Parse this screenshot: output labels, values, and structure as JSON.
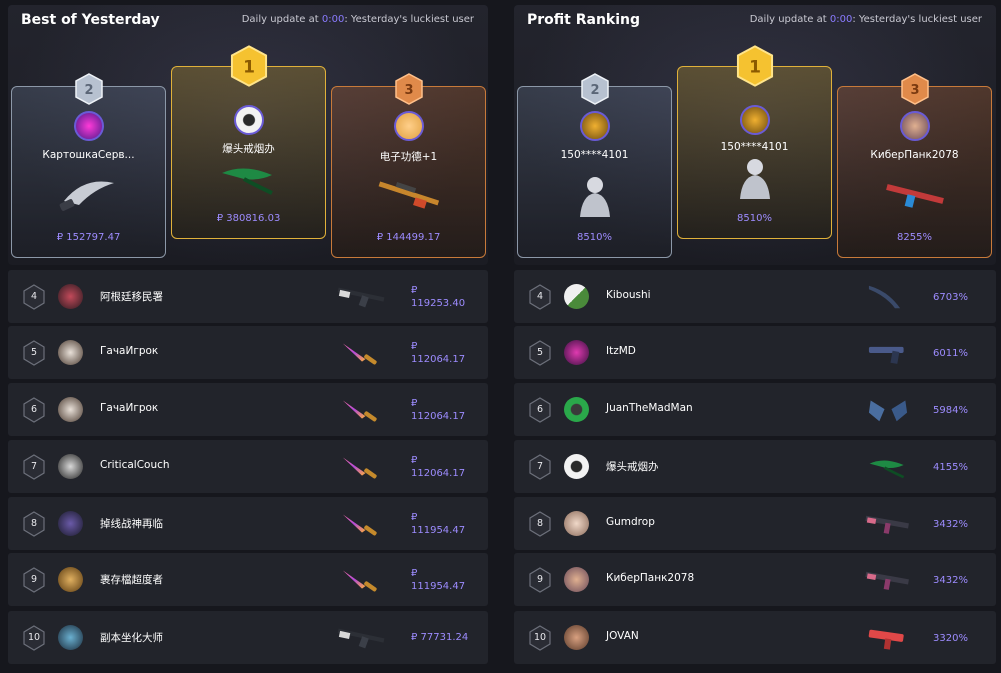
{
  "colors": {
    "accent": "#9d8cff",
    "gold": "#e0b13a",
    "silver": "#8c98a8",
    "bronze": "#c87a3a"
  },
  "left": {
    "title": "Best of Yesterday",
    "sub_prefix": "Daily update at ",
    "sub_time": "0:00",
    "sub_suffix": ": Yesterday's luckiest user",
    "podium": [
      {
        "rank": "2",
        "name": "КартошкаСерв...",
        "value": "₽ 152797.47",
        "item": "knife"
      },
      {
        "rank": "1",
        "name": "爆头戒烟办",
        "value": "₽ 380816.03",
        "item": "green-knife"
      },
      {
        "rank": "3",
        "name": "电子功德+1",
        "value": "₽ 144499.17",
        "item": "sniper-rifle"
      }
    ],
    "rows": [
      {
        "rank": "4",
        "name": "阿根廷移民署",
        "value": "₽\n119253.40",
        "item": "ak47"
      },
      {
        "rank": "5",
        "name": "ГачаИгрок",
        "value": "₽\n112064.17",
        "item": "fade-knife"
      },
      {
        "rank": "6",
        "name": "ГачаИгрок",
        "value": "₽\n112064.17",
        "item": "fade-knife"
      },
      {
        "rank": "7",
        "name": "CriticalCouch",
        "value": "₽\n112064.17",
        "item": "fade-knife"
      },
      {
        "rank": "8",
        "name": "掉线战神再临",
        "value": "₽\n111954.47",
        "item": "fade-knife"
      },
      {
        "rank": "9",
        "name": "裹存檔超度者",
        "value": "₽\n111954.47",
        "item": "fade-knife"
      },
      {
        "rank": "10",
        "name": "副本坐化大师",
        "value": "₽ 77731.24",
        "item": "ak47"
      }
    ]
  },
  "right": {
    "title": "Profit Ranking",
    "sub_prefix": "Daily update at ",
    "sub_time": "0:00",
    "sub_suffix": ": Yesterday's luckiest user",
    "podium": [
      {
        "rank": "2",
        "name": "150****4101",
        "value": "8510%",
        "item": "agent"
      },
      {
        "rank": "1",
        "name": "150****4101",
        "value": "8510%",
        "item": "agent"
      },
      {
        "rank": "3",
        "name": "КиберПанк2078",
        "value": "8255%",
        "item": "red-rifle"
      }
    ],
    "rows": [
      {
        "rank": "4",
        "name": "Kiboushi",
        "value": "6703%",
        "item": "blue-knife"
      },
      {
        "rank": "5",
        "name": "ItzMD",
        "value": "6011%",
        "item": "pistol"
      },
      {
        "rank": "6",
        "name": "JuanTheMadMan",
        "value": "5984%",
        "item": "gloves"
      },
      {
        "rank": "7",
        "name": "爆头戒烟办",
        "value": "4155%",
        "item": "green-knife"
      },
      {
        "rank": "8",
        "name": "Gumdrop",
        "value": "3432%",
        "item": "smg"
      },
      {
        "rank": "9",
        "name": "КиберПанк2078",
        "value": "3432%",
        "item": "smg"
      },
      {
        "rank": "10",
        "name": "JOVAN",
        "value": "3320%",
        "item": "red-smg"
      }
    ]
  }
}
